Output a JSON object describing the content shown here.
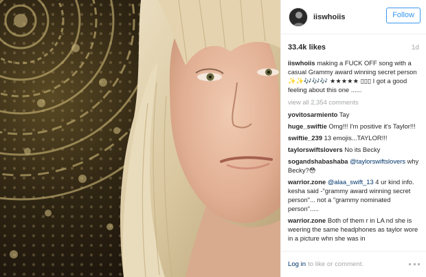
{
  "post": {
    "username": "iiswhoiis",
    "follow_label": "Follow",
    "likes": "33.4k likes",
    "age": "1d"
  },
  "caption": {
    "username": "iiswhoiis",
    "text": "making a FUCK OFF song with a casual Grammy award winning secret person ✨✨🎶🎶🎶 ★★★★★ ▯▯▯ I got a good feeling about this one ......"
  },
  "view_all_label": "view all 2,354 comments",
  "comments": [
    {
      "username": "yovitosarmiento",
      "parts": [
        {
          "text": "Tay"
        }
      ]
    },
    {
      "username": "huge_swiftie",
      "parts": [
        {
          "text": "Omg!!! I'm positive it's Taylor!!!"
        }
      ]
    },
    {
      "username": "swiftie_239",
      "parts": [
        {
          "text": "13 emojis...TAYLOR!!!"
        }
      ]
    },
    {
      "username": "taylorswiftslovers",
      "parts": [
        {
          "text": "No its Becky"
        }
      ]
    },
    {
      "username": "sogandshabashaba",
      "parts": [
        {
          "text": "@taylorswiftslovers",
          "mention": true
        },
        {
          "text": " why Becky?😳"
        }
      ]
    },
    {
      "username": "warrior.zone",
      "parts": [
        {
          "text": "@alaa_swift_13",
          "mention": true
        },
        {
          "text": " 4 ur kind info. kesha said -\"grammy award winning secret person\"... not a \"grammy nominated person\"....."
        }
      ]
    },
    {
      "username": "warrior.zone",
      "parts": [
        {
          "text": "Both of them r in LA nd she is weering the same headphones as taylor wore in a picture whn she was in"
        }
      ]
    }
  ],
  "footer": {
    "login_label": "Log in",
    "login_rest": "to like or comment."
  },
  "icons": {
    "avatar": "profile-avatar",
    "more": "more-options-icon"
  },
  "colors": {
    "link_blue": "#003569",
    "follow_blue": "#3897f0",
    "muted": "#a5a7aa"
  }
}
